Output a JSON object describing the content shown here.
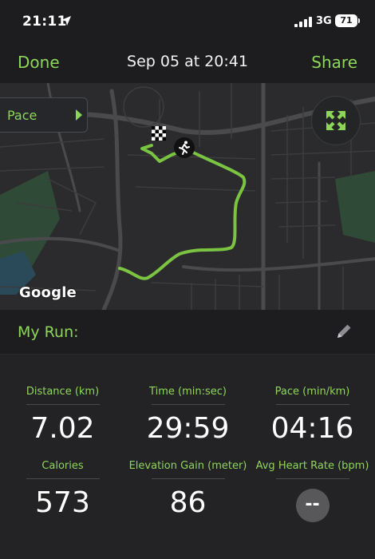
{
  "status": {
    "time": "21:11",
    "network": "3G",
    "battery": "71"
  },
  "nav": {
    "done_label": "Done",
    "title": "Sep 05 at 20:41",
    "share_label": "Share"
  },
  "map": {
    "metric_tab_label": "Pace",
    "attribution": "Google",
    "route_color": "#8ed65a"
  },
  "run": {
    "name_label": "My Run:"
  },
  "stats": [
    {
      "label": "Distance (km)",
      "value": "7.02"
    },
    {
      "label": "Time (min:sec)",
      "value": "29:59"
    },
    {
      "label": "Pace (min/km)",
      "value": "04:16"
    },
    {
      "label": "Calories",
      "value": "573"
    },
    {
      "label": "Elevation Gain (meter)",
      "value": "86"
    },
    {
      "label": "Avg Heart Rate (bpm)",
      "value": "--"
    }
  ],
  "colors": {
    "accent": "#8ed65a",
    "background": "#232325",
    "header": "#1d1d1f"
  },
  "icons": {
    "location": "location-arrow-icon",
    "signal": "cellular-signal-icon",
    "expand": "expand-icon",
    "finish": "checkered-flag-icon",
    "start": "runner-icon",
    "edit": "pencil-icon"
  }
}
